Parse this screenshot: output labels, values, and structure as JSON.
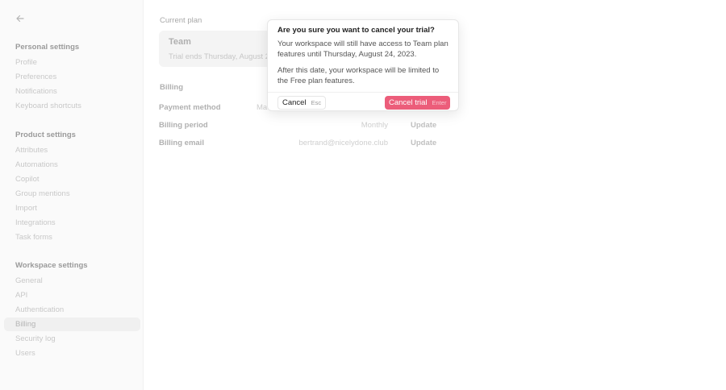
{
  "sidebar": {
    "sections": [
      {
        "title": "Personal settings",
        "items": [
          "Profile",
          "Preferences",
          "Notifications",
          "Keyboard shortcuts"
        ]
      },
      {
        "title": "Product settings",
        "items": [
          "Attributes",
          "Automations",
          "Copilot",
          "Group mentions",
          "Import",
          "Integrations",
          "Task forms"
        ]
      },
      {
        "title": "Workspace settings",
        "items": [
          "General",
          "API",
          "Authentication",
          "Billing",
          "Security log",
          "Users"
        ]
      }
    ],
    "active_item": "Billing"
  },
  "main": {
    "current_plan_label": "Current plan",
    "plan": {
      "name": "Team",
      "trial_text": "Trial ends Thursday, August 24"
    },
    "billing_label": "Billing",
    "rows": [
      {
        "label": "Payment method",
        "value": "Ma",
        "action": ""
      },
      {
        "label": "Billing period",
        "value": "Monthly",
        "action": "Update"
      },
      {
        "label": "Billing email",
        "value": "bertrand@nicelydone.club",
        "action": "Update"
      }
    ]
  },
  "dialog": {
    "title": "Are you sure you want to cancel your trial?",
    "paragraph1": "Your workspace will still have access to Team plan features until Thursday, August 24, 2023.",
    "paragraph2": "After this date, your workspace will be limited to the Free plan features.",
    "cancel_label": "Cancel",
    "cancel_shortcut": "Esc",
    "confirm_label": "Cancel trial",
    "confirm_shortcut": "Enter"
  },
  "colors": {
    "accent": "#ec5d7a",
    "sidebar_bg": "#fafafa"
  }
}
